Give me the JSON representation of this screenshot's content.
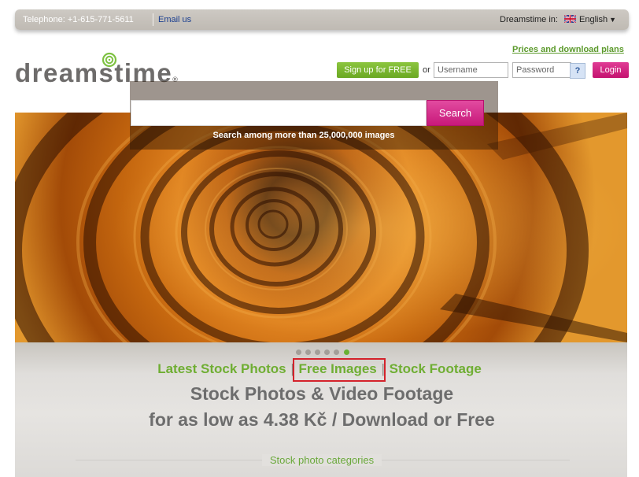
{
  "topbar": {
    "telephone": "Telephone: +1-615-771-5611",
    "email": "Email us",
    "dreamstime_in": "Dreamstime in:",
    "language": "English"
  },
  "logo": {
    "text": "dreamstime",
    "reg": "®"
  },
  "header": {
    "prices_link": "Prices and download plans",
    "signup_label": "Sign up for FREE",
    "or": "or",
    "username_placeholder": "Username",
    "password_placeholder": "Password",
    "help": "?",
    "login_label": "Login"
  },
  "hero": {
    "search_value": "",
    "search_button": "Search",
    "caption": "Search among more than 25,000,000 images"
  },
  "carousel": {
    "dot_count": 6,
    "active_index": 5
  },
  "nav": {
    "latest": "Latest Stock Photos",
    "free": "Free Images",
    "footage": "Stock Footage",
    "separator": "|"
  },
  "headline": {
    "line1": "Stock Photos & Video Footage",
    "line2": "for as low as 4.38 Kč / Download or Free"
  },
  "categories_label": "Stock photo categories",
  "colors": {
    "green": "#6fae33",
    "pink": "#c8197a",
    "highlight": "#d4222b"
  }
}
